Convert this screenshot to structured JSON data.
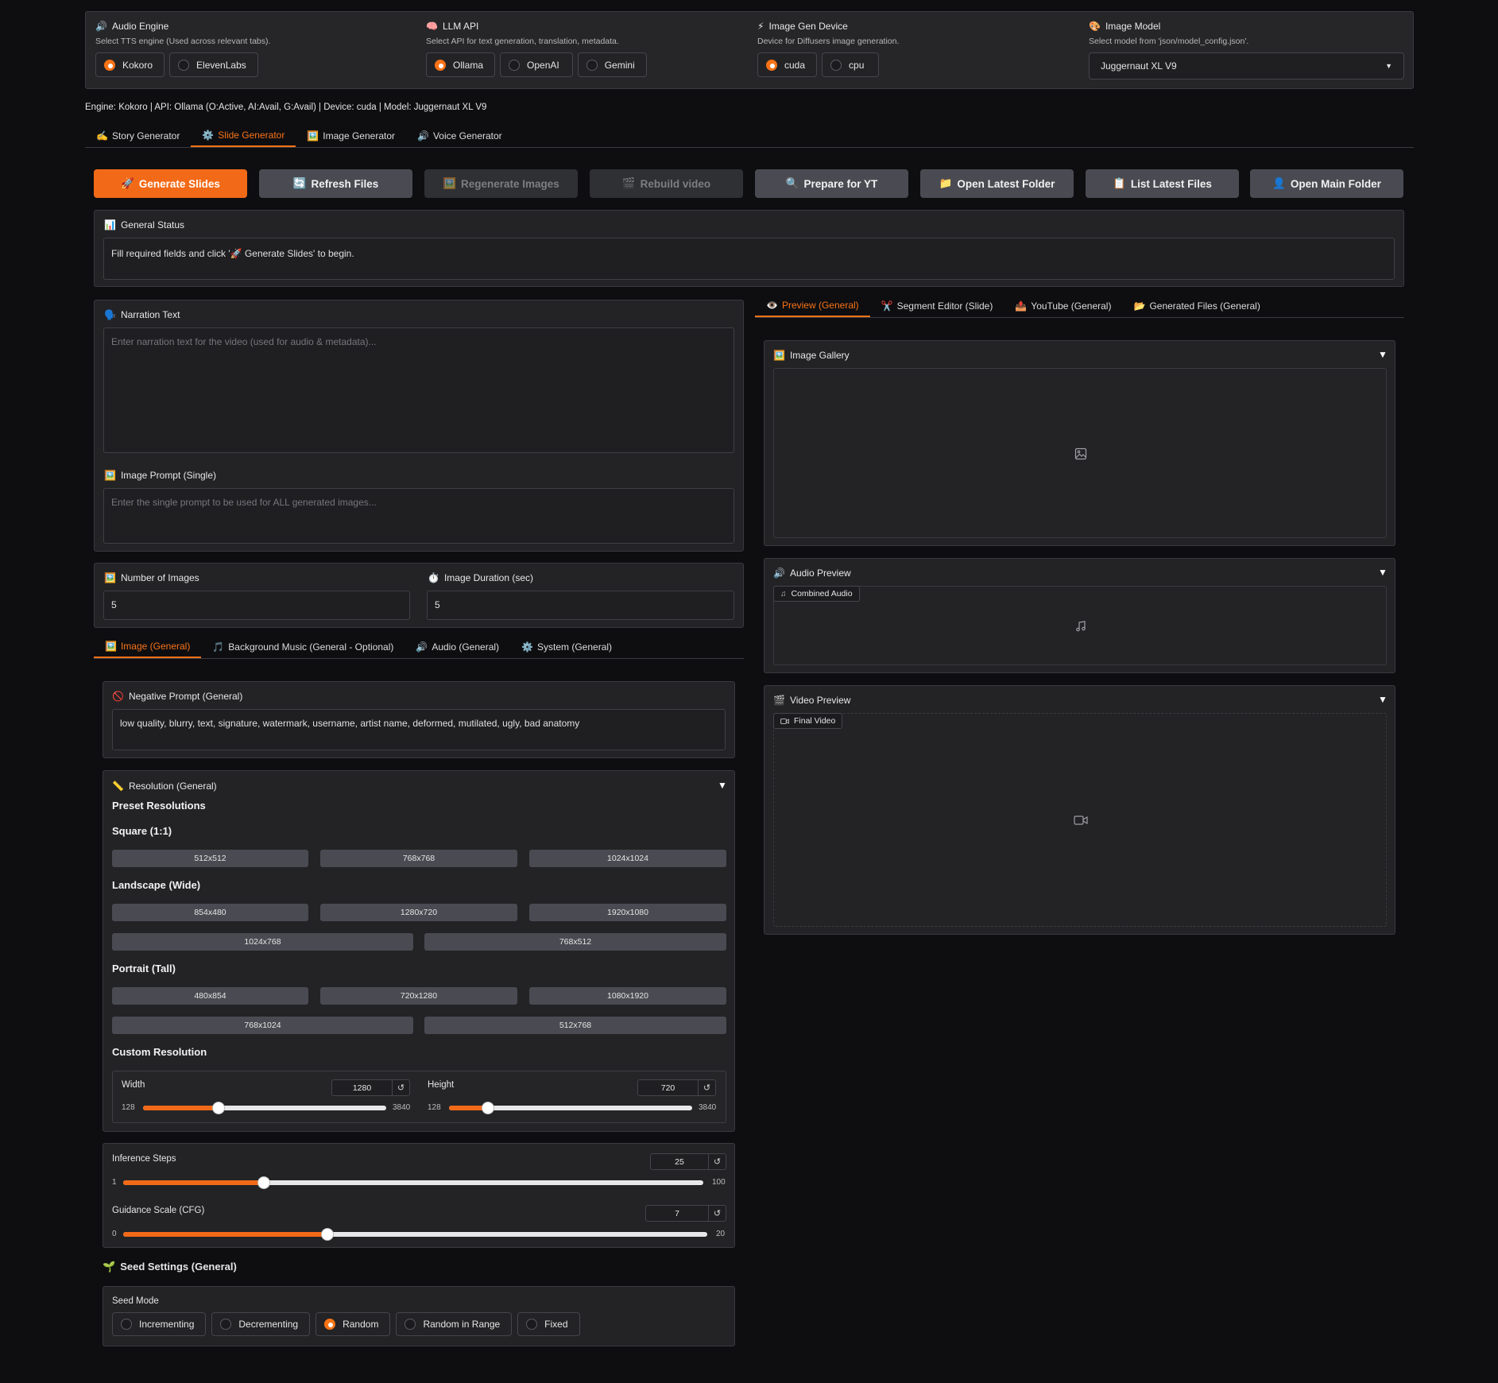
{
  "settings": {
    "audio_engine": {
      "icon": "speaker-icon",
      "title": "Audio Engine",
      "desc": "Select TTS engine (Used across relevant tabs).",
      "options": [
        "Kokoro",
        "ElevenLabs"
      ],
      "selected": "Kokoro"
    },
    "llm_api": {
      "icon": "brain-icon",
      "title": "LLM API",
      "desc": "Select API for text generation, translation, metadata.",
      "options": [
        "Ollama",
        "OpenAI",
        "Gemini"
      ],
      "selected": "Ollama"
    },
    "device": {
      "icon": "lightning-icon",
      "title": "Image Gen Device",
      "desc": "Device for Diffusers image generation.",
      "options": [
        "cuda",
        "cpu"
      ],
      "selected": "cuda"
    },
    "model": {
      "icon": "palette-icon",
      "title": "Image Model",
      "desc": "Select model from 'json/model_config.json'.",
      "value": "Juggernaut XL V9"
    }
  },
  "status_line": "Engine: Kokoro | API: Ollama (O:Active, AI:Avail, G:Avail) | Device: cuda | Model: Juggernaut XL V9",
  "main_tabs": [
    {
      "icon": "✍️",
      "label": "Story Generator"
    },
    {
      "icon": "⚙️",
      "label": "Slide Generator"
    },
    {
      "icon": "🖼️",
      "label": "Image Generator"
    },
    {
      "icon": "🔊",
      "label": "Voice Generator"
    }
  ],
  "active_main_tab": "Slide Generator",
  "actions": [
    {
      "icon": "🚀",
      "label": "Generate Slides"
    },
    {
      "icon": "🔄",
      "label": "Refresh Files"
    },
    {
      "icon": "🖼️",
      "label": "Regenerate Images"
    },
    {
      "icon": "🎬",
      "label": "Rebuild video"
    },
    {
      "icon": "🔍",
      "label": "Prepare for YT"
    },
    {
      "icon": "📁",
      "label": "Open Latest Folder"
    },
    {
      "icon": "📋",
      "label": "List Latest Files"
    },
    {
      "icon": "👤",
      "label": "Open Main Folder"
    }
  ],
  "general_status": {
    "icon": "📊",
    "title": "General Status",
    "text": "Fill required fields and click '🚀 Generate Slides' to begin."
  },
  "narration": {
    "icon": "🗣️",
    "label": "Narration Text",
    "placeholder": "Enter narration text for the video (used for audio & metadata)..."
  },
  "image_prompt": {
    "icon": "🖼️",
    "label": "Image Prompt (Single)",
    "placeholder": "Enter the single prompt to be used for ALL generated images..."
  },
  "num_images": {
    "icon": "🖼️",
    "label": "Number of Images",
    "value": "5"
  },
  "image_duration": {
    "icon": "⏱️",
    "label": "Image Duration (sec)",
    "value": "5"
  },
  "sub_tabs": [
    {
      "icon": "🖼️",
      "label": "Image (General)"
    },
    {
      "icon": "🎵",
      "label": "Background Music (General - Optional)"
    },
    {
      "icon": "🔊",
      "label": "Audio (General)"
    },
    {
      "icon": "⚙️",
      "label": "System (General)"
    }
  ],
  "active_sub_tab": "Image (General)",
  "negative_prompt": {
    "icon": "🚫",
    "label": "Negative Prompt (General)",
    "value": "low quality, blurry, text, signature, watermark, username, artist name, deformed, mutilated, ugly, bad anatomy"
  },
  "resolution": {
    "icon": "📏",
    "title": "Resolution (General)",
    "preset_heading": "Preset Resolutions",
    "square_heading": "Square (1:1)",
    "square": [
      "512x512",
      "768x768",
      "1024x1024"
    ],
    "landscape_heading": "Landscape (Wide)",
    "landscape_row1": [
      "854x480",
      "1280x720",
      "1920x1080"
    ],
    "landscape_row2": [
      "1024x768",
      "768x512"
    ],
    "portrait_heading": "Portrait (Tall)",
    "portrait_row1": [
      "480x854",
      "720x1280",
      "1080x1920"
    ],
    "portrait_row2": [
      "768x1024",
      "512x768"
    ],
    "custom_heading": "Custom Resolution",
    "width": {
      "label": "Width",
      "value": 1280,
      "min": 128,
      "max": 3840
    },
    "height": {
      "label": "Height",
      "value": 720,
      "min": 128,
      "max": 3840
    }
  },
  "inference_steps": {
    "label": "Inference Steps",
    "value": 25,
    "min": 1,
    "max": 100
  },
  "guidance": {
    "label": "Guidance Scale (CFG)",
    "value": 7,
    "min": 0,
    "max": 20
  },
  "seed": {
    "icon": "🌱",
    "title": "Seed Settings (General)",
    "mode_label": "Seed Mode",
    "options": [
      "Incrementing",
      "Decrementing",
      "Random",
      "Random in Range",
      "Fixed"
    ],
    "selected": "Random"
  },
  "right_tabs": [
    {
      "icon": "👁️",
      "label": "Preview (General)"
    },
    {
      "icon": "✂️",
      "label": "Segment Editor (Slide)"
    },
    {
      "icon": "📤",
      "label": "YouTube (General)"
    },
    {
      "icon": "📂",
      "label": "Generated Files (General)"
    }
  ],
  "active_right_tab": "Preview (General)",
  "gallery": {
    "icon": "🖼️",
    "title": "Image Gallery"
  },
  "audio_preview": {
    "icon": "🔊",
    "title": "Audio Preview",
    "chip": "Combined Audio"
  },
  "video_preview": {
    "icon": "🎬",
    "title": "Video Preview",
    "chip": "Final Video"
  },
  "colors": {
    "accent": "#f26a17",
    "background": "#0e0e11",
    "panel": "#232326"
  }
}
